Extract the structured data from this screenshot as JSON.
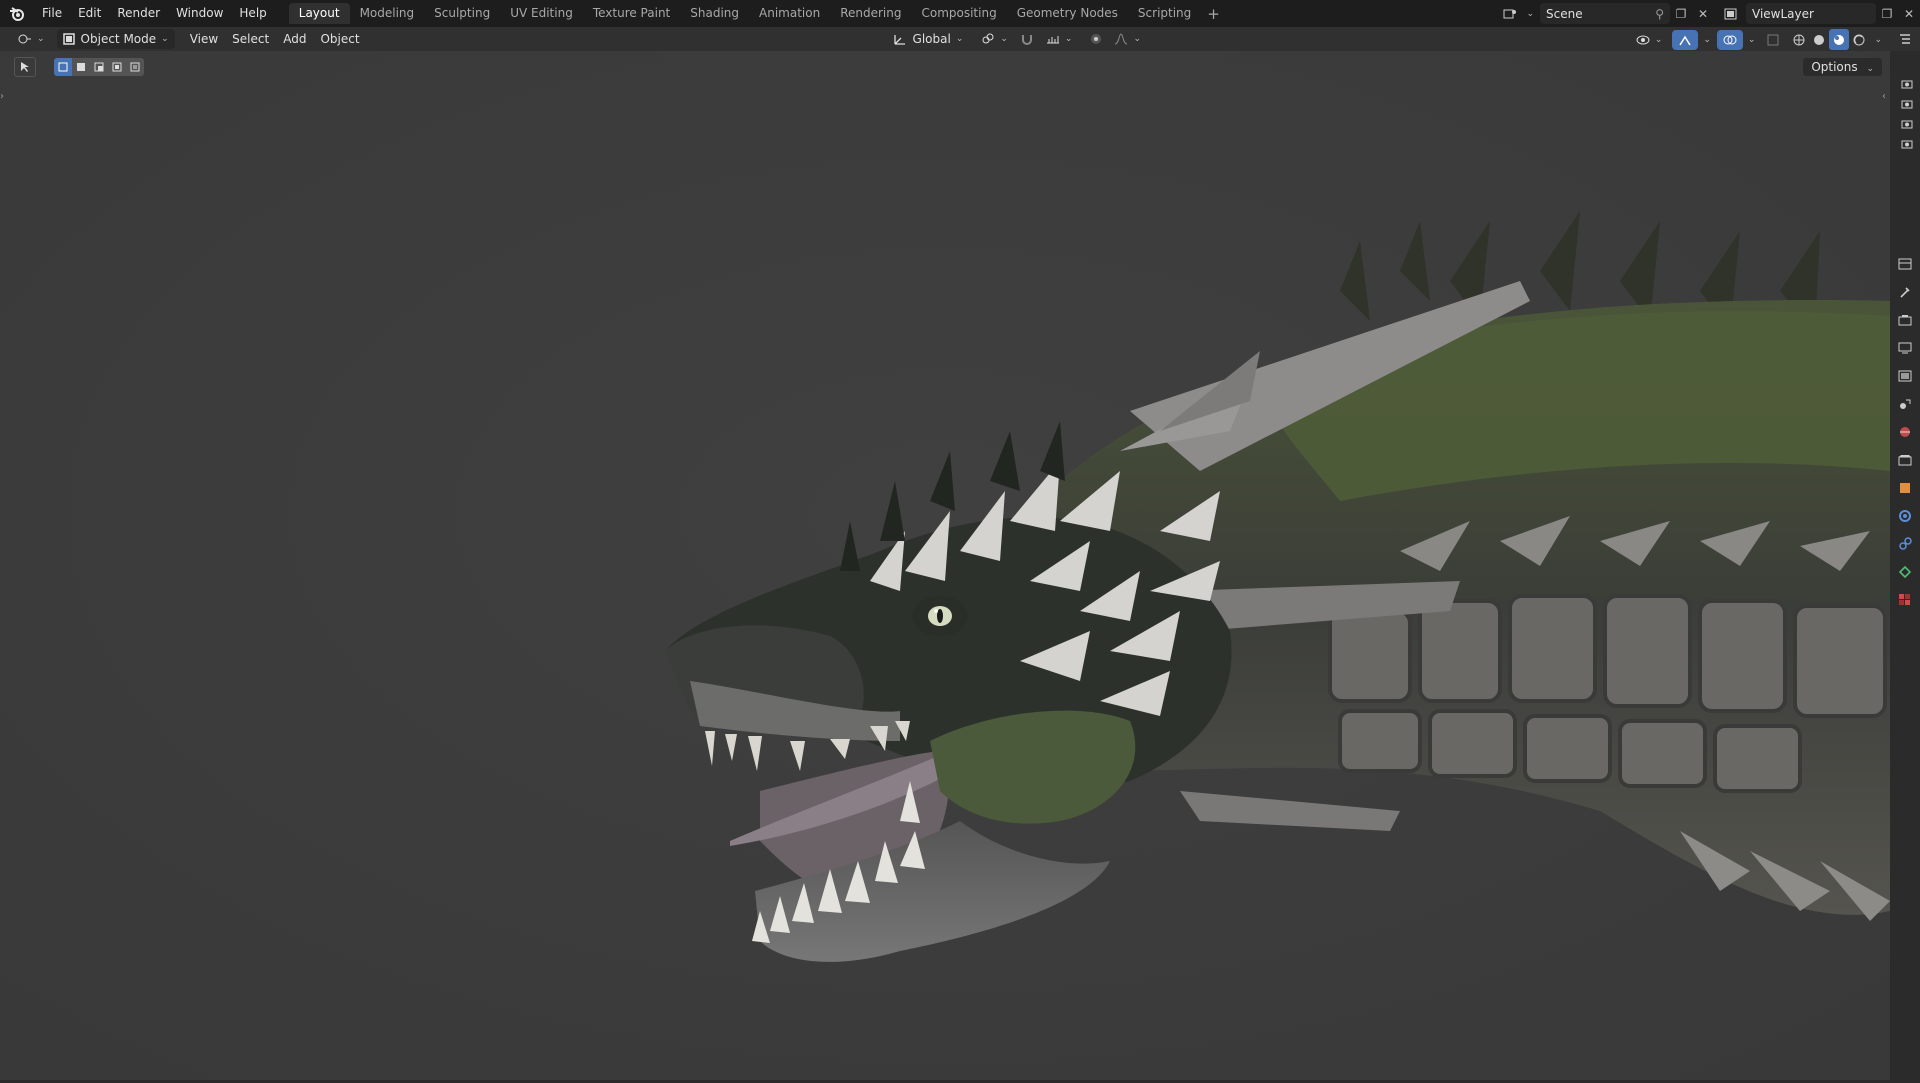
{
  "top_menu": [
    "File",
    "Edit",
    "Render",
    "Window",
    "Help"
  ],
  "workspaces": [
    {
      "label": "Layout",
      "active": true
    },
    {
      "label": "Modeling",
      "active": false
    },
    {
      "label": "Sculpting",
      "active": false
    },
    {
      "label": "UV Editing",
      "active": false
    },
    {
      "label": "Texture Paint",
      "active": false
    },
    {
      "label": "Shading",
      "active": false
    },
    {
      "label": "Animation",
      "active": false
    },
    {
      "label": "Rendering",
      "active": false
    },
    {
      "label": "Compositing",
      "active": false
    },
    {
      "label": "Geometry Nodes",
      "active": false
    },
    {
      "label": "Scripting",
      "active": false
    }
  ],
  "workspace_add": "+",
  "scene": {
    "name": "Scene"
  },
  "view_layer": {
    "name": "ViewLayer"
  },
  "viewport_header": {
    "mode": "Object Mode",
    "menus": [
      "View",
      "Select",
      "Add",
      "Object"
    ],
    "transform_orientation": "Global"
  },
  "options_label": "Options",
  "colors": {
    "topbar": "#1d1d1d",
    "header": "#303030",
    "viewport_bg": "#3c3c3c",
    "accent_blue": "#4772b3"
  }
}
